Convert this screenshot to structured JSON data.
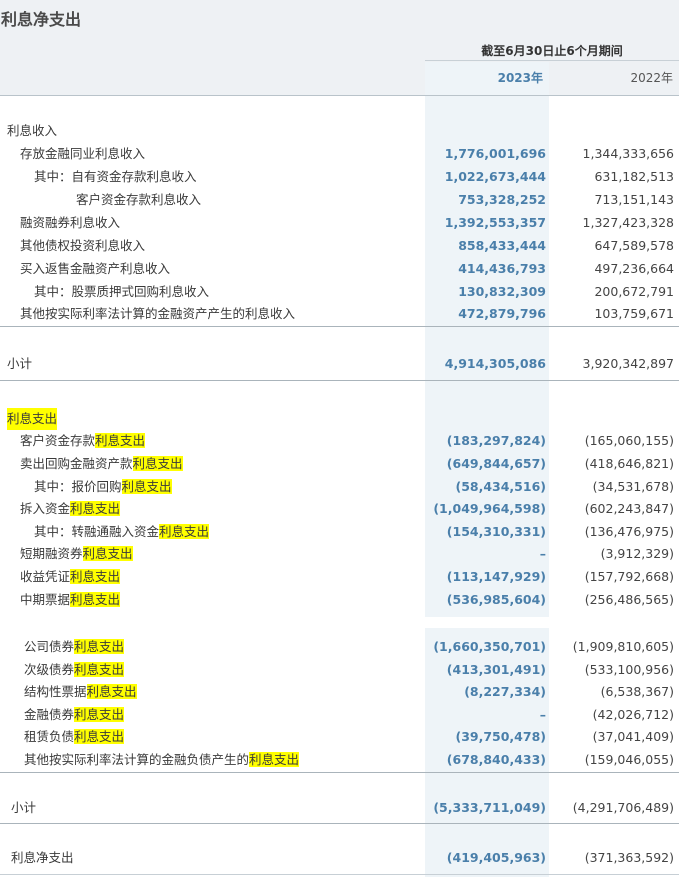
{
  "title": "利息净支出",
  "header": {
    "period": "截至6月30日止6个月期间",
    "year_current": "2023年",
    "year_prior": "2022年"
  },
  "income_section_label": "利息收入",
  "income_rows": [
    {
      "label": "存放金融同业利息收入",
      "current": "1,776,001,696",
      "prior": "1,344,333,656"
    },
    {
      "label": "其中：自有资金存款利息收入",
      "current": "1,022,673,444",
      "prior": "631,182,513"
    },
    {
      "label": "客户资金存款利息收入",
      "current": "753,328,252",
      "prior": "713,151,143"
    },
    {
      "label": "融资融券利息收入",
      "current": "1,392,553,357",
      "prior": "1,327,423,328"
    },
    {
      "label": "其他债权投资利息收入",
      "current": "858,433,444",
      "prior": "647,589,578"
    },
    {
      "label": "买入返售金融资产利息收入",
      "current": "414,436,793",
      "prior": "497,236,664"
    },
    {
      "label": "其中：股票质押式回购利息收入",
      "current": "130,832,309",
      "prior": "200,672,791"
    },
    {
      "label": "其他按实际利率法计算的金融资产产生的利息收入",
      "current": "472,879,796",
      "prior": "103,759,671"
    }
  ],
  "income_subtotal": {
    "label": "小计",
    "current": "4,914,305,086",
    "prior": "3,920,342,897"
  },
  "expense_section_label": "利息支出",
  "expense_rows": [
    {
      "pre": "客户资金存款",
      "hl": "利息支出",
      "current": "(183,297,824)",
      "prior": "(165,060,155)"
    },
    {
      "pre": "卖出回购金融资产款",
      "hl": "利息支出",
      "current": "(649,844,657)",
      "prior": "(418,646,821)"
    },
    {
      "pre": "其中：报价回购",
      "hl": "利息支出",
      "current": "(58,434,516)",
      "prior": "(34,531,678)"
    },
    {
      "pre": "拆入资金",
      "hl": "利息支出",
      "current": "(1,049,964,598)",
      "prior": "(602,243,847)"
    },
    {
      "pre": "其中：转融通融入资金",
      "hl": "利息支出",
      "current": "(154,310,331)",
      "prior": "(136,476,975)"
    },
    {
      "pre": "短期融资券",
      "hl": "利息支出",
      "current": "–",
      "prior": "(3,912,329)"
    },
    {
      "pre": "收益凭证",
      "hl": "利息支出",
      "current": "(113,147,929)",
      "prior": "(157,792,668)"
    },
    {
      "pre": "中期票据",
      "hl": "利息支出",
      "current": "(536,985,604)",
      "prior": "(256,486,565)"
    },
    {
      "pre": "公司债券",
      "hl": "利息支出",
      "current": "(1,660,350,701)",
      "prior": "(1,909,810,605)"
    },
    {
      "pre": "次级债券",
      "hl": "利息支出",
      "current": "(413,301,491)",
      "prior": "(533,100,956)"
    },
    {
      "pre": "结构性票据",
      "hl": "利息支出",
      "current": "(8,227,334)",
      "prior": "(6,538,367)"
    },
    {
      "pre": "金融债券",
      "hl": "利息支出",
      "current": "–",
      "prior": "(42,026,712)"
    },
    {
      "pre": "租赁负债",
      "hl": "利息支出",
      "current": "(39,750,478)",
      "prior": "(37,041,409)"
    },
    {
      "pre": "其他按实际利率法计算的金融负债产生的",
      "hl": "利息支出",
      "current": "(678,840,433)",
      "prior": "(159,046,055)"
    }
  ],
  "expense_subtotal": {
    "label": "小计",
    "current": "(5,333,711,049)",
    "prior": "(4,291,706,489)"
  },
  "net": {
    "label": "利息净支出",
    "current": "(419,405,963)",
    "prior": "(371,363,592)"
  },
  "colors": {
    "accent": "#4a7faa",
    "highlight": "#ffff00",
    "header_bg": "#eef1f4"
  }
}
